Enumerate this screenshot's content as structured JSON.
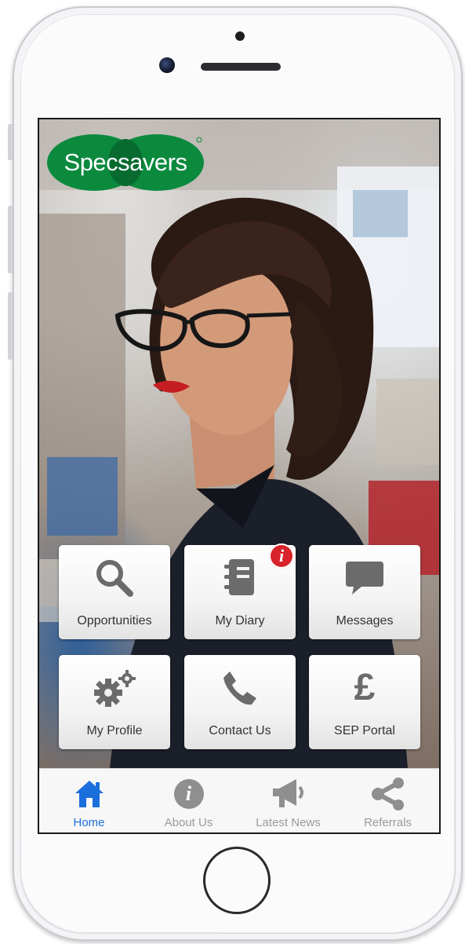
{
  "app": {
    "brand": "Specsavers",
    "brand_color": "#0b8a3e",
    "accent_color": "#1a6fdc",
    "badge_color": "#d8232a"
  },
  "tiles": [
    {
      "label": "Opportunities",
      "icon": "search-icon"
    },
    {
      "label": "My Diary",
      "icon": "notebook-icon",
      "badge": "i"
    },
    {
      "label": "Messages",
      "icon": "chat-bubble-icon"
    },
    {
      "label": "My Profile",
      "icon": "gears-icon"
    },
    {
      "label": "Contact Us",
      "icon": "phone-icon"
    },
    {
      "label": "SEP Portal",
      "icon": "pound-icon",
      "glyph": "£"
    }
  ],
  "tabs": [
    {
      "label": "Home",
      "icon": "home-icon",
      "active": true
    },
    {
      "label": "About Us",
      "icon": "info-icon",
      "glyph": "i"
    },
    {
      "label": "Latest News",
      "icon": "megaphone-icon"
    },
    {
      "label": "Referrals",
      "icon": "share-icon"
    }
  ]
}
